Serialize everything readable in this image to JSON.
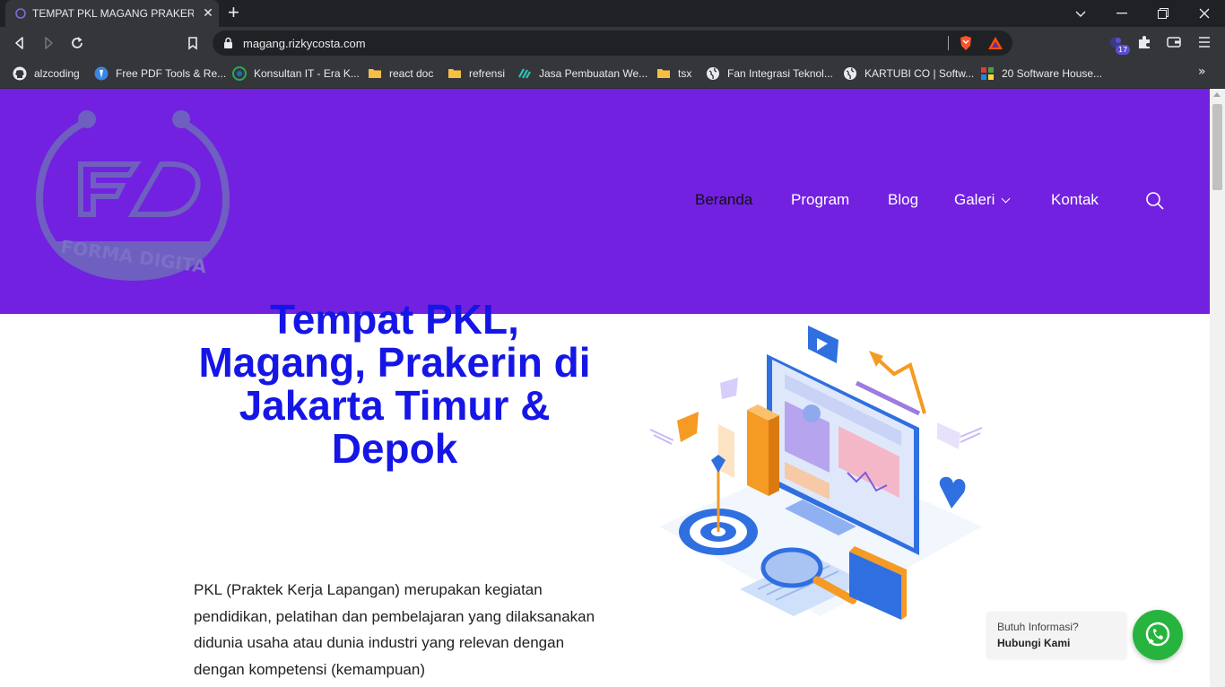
{
  "browser": {
    "tab_title": "TEMPAT PKL MAGANG PRAKERIN",
    "tab_close": "✕",
    "new_tab": "+",
    "url": "magang.rizkycosta.com",
    "extensions_badge": "17",
    "bookmarks": [
      {
        "label": "alzcoding",
        "icon": "github-icon"
      },
      {
        "label": "Free PDF Tools & Re...",
        "icon": "pdf-tools-icon"
      },
      {
        "label": "Konsultan IT - Era K...",
        "icon": "globe-green-icon"
      },
      {
        "label": "react doc",
        "icon": "folder-icon"
      },
      {
        "label": "refrensi",
        "icon": "folder-icon"
      },
      {
        "label": "Jasa Pembuatan We...",
        "icon": "teal-logo-icon"
      },
      {
        "label": "tsx",
        "icon": "folder-icon"
      },
      {
        "label": "Fan Integrasi Teknol...",
        "icon": "globe-icon"
      },
      {
        "label": "KARTUBI CO | Softw...",
        "icon": "globe-icon"
      },
      {
        "label": "20 Software House...",
        "icon": "colorful-grid-icon"
      }
    ],
    "bookmarks_more": "»"
  },
  "header": {
    "logo_text": "FORMA DIGITA",
    "nav": [
      {
        "label": "Beranda",
        "active": true
      },
      {
        "label": "Program",
        "active": false
      },
      {
        "label": "Blog",
        "active": false
      },
      {
        "label": "Galeri",
        "active": false,
        "dropdown": true
      },
      {
        "label": "Kontak",
        "active": false
      }
    ],
    "background_color": "#7221e0"
  },
  "hero": {
    "headline": "Tempat PKL, Magang, Prakerin di Jakarta Timur & Depok",
    "paragraph": "PKL (Praktek Kerja Lapangan) merupakan kegiatan pendidikan, pelatihan dan pembelajaran yang dilaksanakan didunia usaha atau dunia industri yang relevan dengan dengan kompetensi (kemampuan)",
    "headline_color": "#1516e6"
  },
  "whatsapp": {
    "line1": "Butuh Informasi?",
    "line2": "Hubungi Kami",
    "color": "#27b43e"
  }
}
